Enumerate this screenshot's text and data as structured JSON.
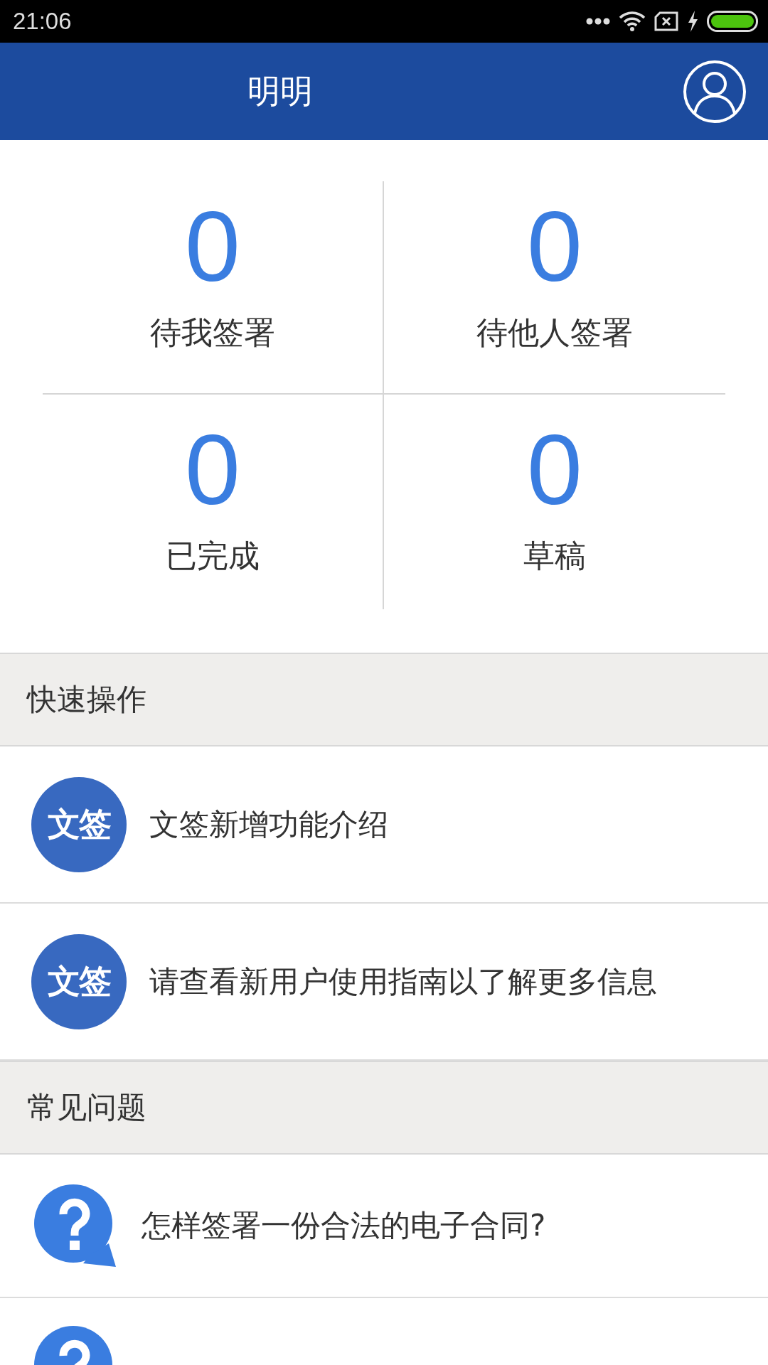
{
  "status_bar": {
    "time": "21:06"
  },
  "header": {
    "title": "明明"
  },
  "stats": [
    {
      "count": "0",
      "label": "待我签署"
    },
    {
      "count": "0",
      "label": "待他人签署"
    },
    {
      "count": "0",
      "label": "已完成"
    },
    {
      "count": "0",
      "label": "草稿"
    }
  ],
  "quick_actions": {
    "title": "快速操作",
    "items": [
      {
        "badge": "文签",
        "label": "文签新增功能介绍"
      },
      {
        "badge": "文签",
        "label": "请查看新用户使用指南以了解更多信息"
      }
    ]
  },
  "faq": {
    "title": "常见问题",
    "items": [
      {
        "kind": "question",
        "question": "怎样签署一份合法的电子合同?"
      },
      {
        "kind": "question"
      }
    ]
  }
}
